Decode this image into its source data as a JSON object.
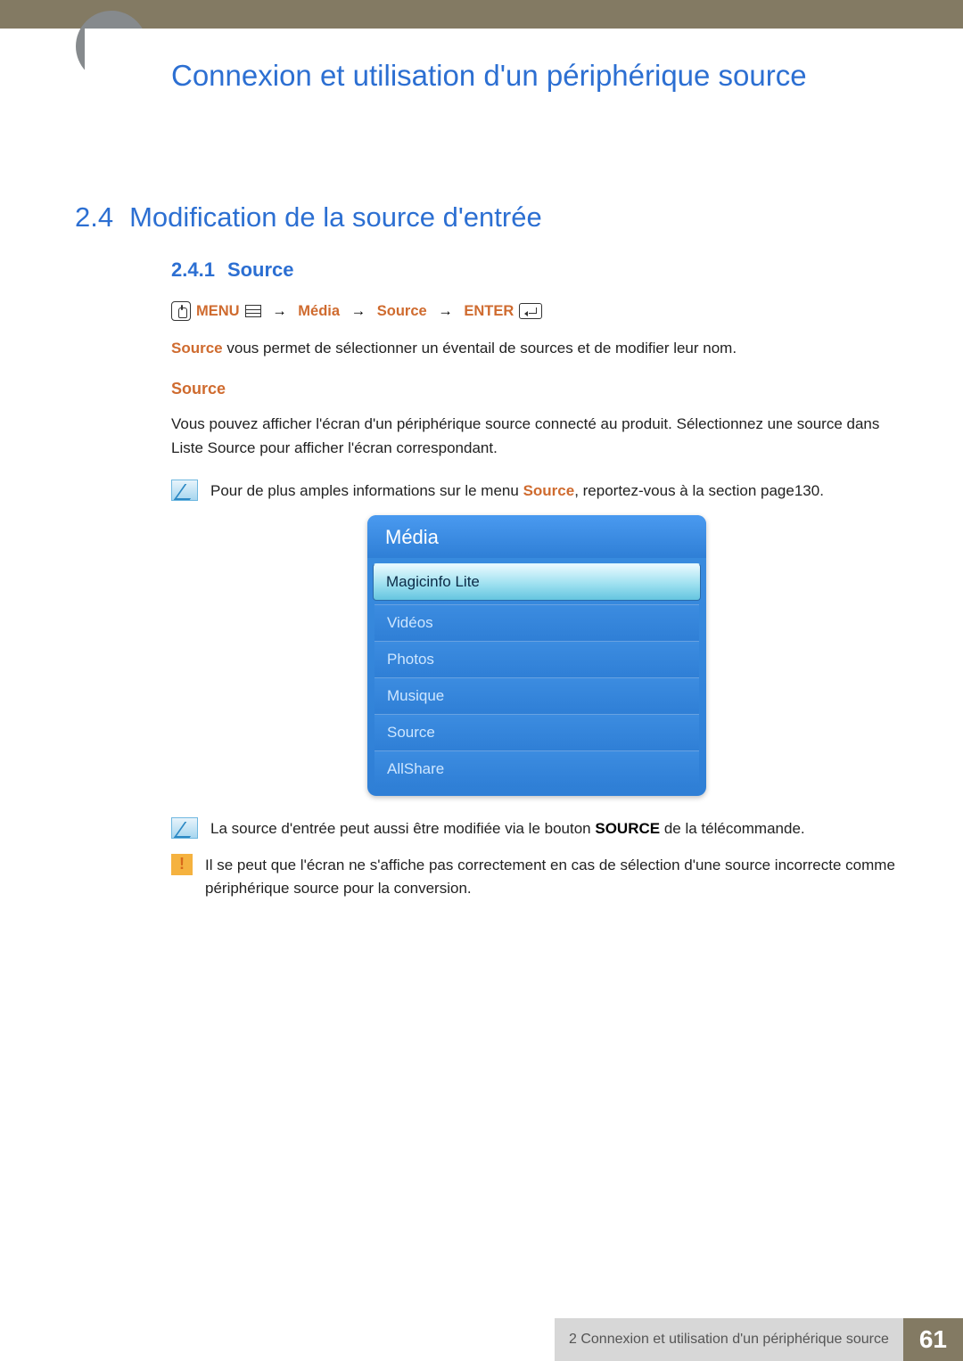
{
  "chapter_title": "Connexion et utilisation d'un périphérique source",
  "section": {
    "number": "2.4",
    "title": "Modification de la source d'entrée"
  },
  "subsection": {
    "number": "2.4.1",
    "title": "Source"
  },
  "nav": {
    "menu": "MENU",
    "arrow": "→",
    "media": "Média",
    "source": "Source",
    "enter": "ENTER"
  },
  "para1_lead": "Source",
  "para1_rest": " vous permet de sélectionner un éventail de sources et de modifier leur nom.",
  "source_heading": "Source",
  "para2": "Vous pouvez afficher l'écran d'un périphérique source connecté au produit. Sélectionnez une source dans Liste Source pour afficher l'écran correspondant.",
  "note1_pre": "Pour de plus amples informations sur le menu ",
  "note1_bold": "Source",
  "note1_post": ", reportez-vous à la section page130.",
  "osd": {
    "title": "Média",
    "items": [
      "Magicinfo Lite",
      "Vidéos",
      "Photos",
      "Musique",
      "Source",
      "AllShare"
    ],
    "selected_index": 0
  },
  "note2_pre": "La source d'entrée peut aussi être modifiée via le bouton ",
  "note2_bold": "SOURCE",
  "note2_post": " de la télécommande.",
  "note3": "Il se peut que l'écran ne s'affiche pas correctement en cas de sélection d'une source incorrecte comme périphérique source pour la conversion.",
  "footer": {
    "text": "2 Connexion et utilisation d'un périphérique source",
    "page": "61"
  }
}
